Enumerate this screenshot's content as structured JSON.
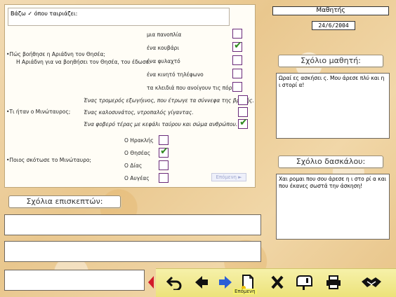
{
  "quiz": {
    "instruction": "Βάζω ✓ όπου ταιριάζει:",
    "q1": {
      "question_line1": "•Πώς βοήθησε η Αριάδνη τον Θησέα;",
      "question_line2": "Η Αριάδνη για να βοηθήσει τον Θησέα, του έδωσε:",
      "options": [
        "μια πανοπλία",
        "ένα κουβάρι",
        "ένα φυλαχτό",
        "ένα κινητό τηλέφωνο",
        "τα κλειδιά που ανοίγουν τις πόρτες"
      ],
      "checked": [
        false,
        true,
        false,
        false,
        false
      ]
    },
    "q2": {
      "question": "•Τι ήταν ο Μινώταυρος;",
      "options": [
        "Ένας τρομερός εξωγήινος, που έτρωγε τα σύννεφα της βροχής.",
        "Ένας καλοσυνάτος, ντροπαλός γίγαντας.",
        "Ένα φοβερό τέρας με κεφάλι ταύρου και σώμα ανθρώπου."
      ],
      "checked": [
        false,
        false,
        true
      ]
    },
    "q3": {
      "question": "•Ποιος σκότωσε το Μινώταυρο;",
      "options": [
        "Ο Ηρακλής",
        "Ο Θησέας",
        "Ο Δίας",
        "Ο Αυγέας"
      ],
      "checked": [
        false,
        true,
        false,
        false
      ]
    },
    "next_small": "Επόμενη ►"
  },
  "header": {
    "title": "Μαθητής",
    "date": "24/6/2004"
  },
  "student_comment": {
    "label": "Σχόλιο μαθητή:",
    "text": "Ωραί ες ασκήσει ς. Μου άρεσε πλύ και η ι στορί α!"
  },
  "teacher_comment": {
    "label": "Σχόλιο δασκάλου:",
    "text": "Χαι ρομαι που σου άρεσε η ι στο ρί α και που έκανες σωστά την άσκηση!"
  },
  "visitor_comments": {
    "label": "Σχόλια επισκεπτών:",
    "entries": [
      "",
      "",
      ""
    ]
  },
  "toolbar": {
    "next_label": "Επόμενη",
    "accent": "#d21a2a"
  }
}
